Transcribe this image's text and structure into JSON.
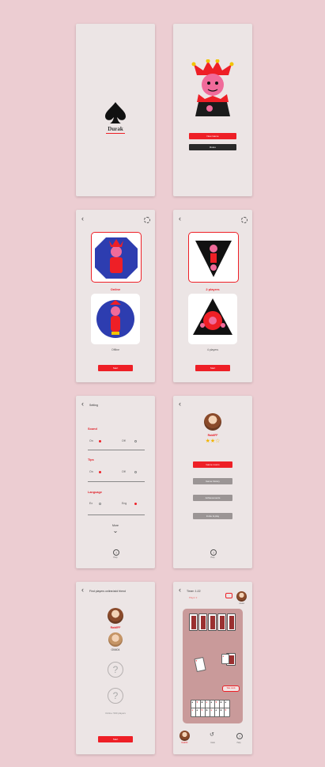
{
  "colors": {
    "background": "#eccdd2",
    "screen": "#ece5e5",
    "accent": "#ee1f26",
    "dark": "#2a2a2a",
    "grey_button": "#9b9595"
  },
  "splash": {
    "title": "Durak",
    "icon": "spade-icon"
  },
  "start": {
    "primary_button": "New Game",
    "secondary_button": "Rules"
  },
  "mode_select": {
    "option1": "Online",
    "option2": "Offline",
    "start_button": "Start"
  },
  "players_select": {
    "option1": "2 players",
    "option2": "4 players",
    "start_button": "Start"
  },
  "settings": {
    "title": "Setting",
    "sound": {
      "label": "Sound",
      "on": "On",
      "off": "Off"
    },
    "tips": {
      "label": "Tips",
      "on": "On",
      "off": "Off"
    },
    "language": {
      "label": "Language",
      "opt1": "Ex",
      "opt2": "Eng"
    },
    "more": "More",
    "help": "Help"
  },
  "profile": {
    "name": "RaidIFF",
    "stars_filled": 2,
    "stars_total": 3,
    "buttons": [
      "Game rooms",
      "Game history",
      "Achievements",
      "Invite & play"
    ],
    "help": "Help"
  },
  "find": {
    "title": "Find players online/add friend",
    "player1": "RaidIFF",
    "player2": "Olli404",
    "online": "Online: 500 players",
    "start_button": "Start"
  },
  "game": {
    "timer": "Timer: 1:22",
    "player_label": "Player 2",
    "opponent_name": "Olli404",
    "badge": "Take cards",
    "player_name": "RaidIFF",
    "undo": "Undo",
    "help": "Help"
  }
}
